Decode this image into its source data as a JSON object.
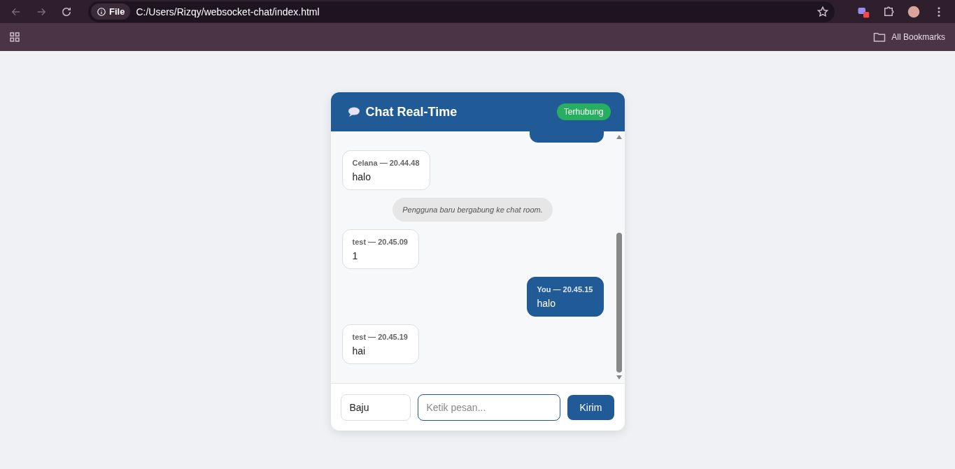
{
  "browser": {
    "url_chip": "File",
    "url": "C:/Users/Rizqy/websocket-chat/index.html",
    "bookmarks_label": "All Bookmarks"
  },
  "chat": {
    "title": "Chat Real-Time",
    "status": "Terhubung",
    "connected": true,
    "messages": [
      {
        "kind": "own",
        "clipped": true
      },
      {
        "kind": "other",
        "meta": "Celana — 20.44.48",
        "text": "halo"
      },
      {
        "kind": "system",
        "text": "Pengguna baru bergabung ke chat room."
      },
      {
        "kind": "other",
        "meta": "test — 20.45.09",
        "text": "1"
      },
      {
        "kind": "own",
        "meta": "You — 20.45.15",
        "text": "halo"
      },
      {
        "kind": "other",
        "meta": "test — 20.45.19",
        "text": "hai"
      }
    ],
    "name_value": "Baju",
    "message_placeholder": "Ketik pesan...",
    "send_label": "Kirim"
  }
}
